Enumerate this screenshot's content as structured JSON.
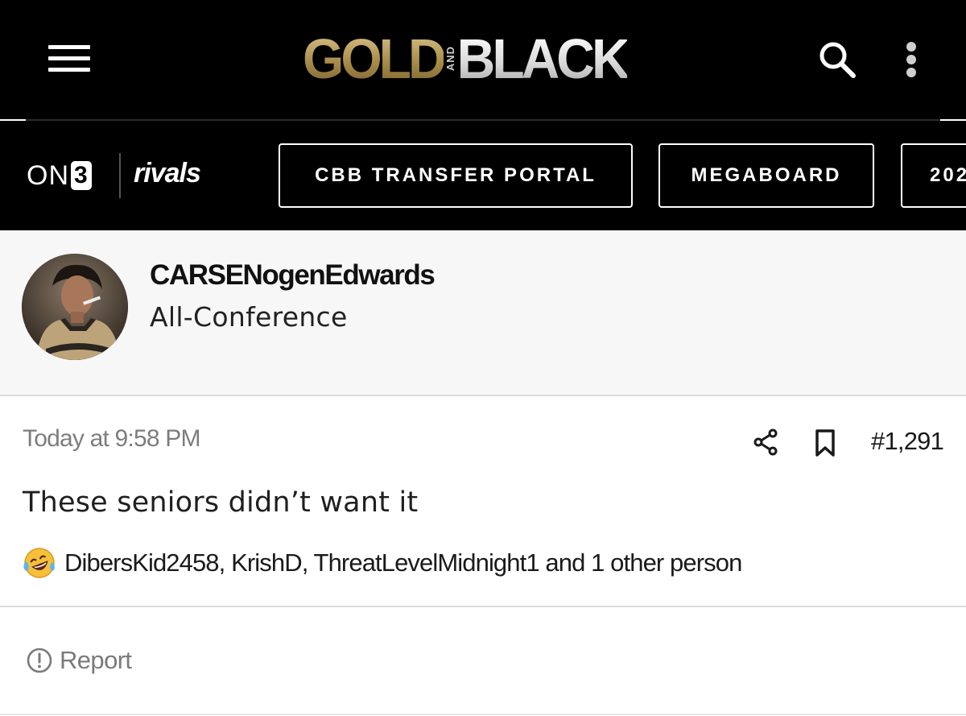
{
  "header": {
    "logo_gold": "GOLD",
    "logo_and": "AND",
    "logo_black": "BLACK",
    "menu_icon": "hamburger-menu-icon",
    "search_icon": "search-icon",
    "more_icon": "more-vertical-icon"
  },
  "subnav": {
    "brand_on3": "ON",
    "brand_on3_digit": "3",
    "brand_rivals": "rivals",
    "pills": [
      {
        "label": "CBB TRANSFER PORTAL"
      },
      {
        "label": "MEGABOARD"
      },
      {
        "label": "202"
      }
    ]
  },
  "author": {
    "username": "CARSENogenEdwards",
    "title": "All-Conference",
    "avatar_desc": "avatar"
  },
  "post": {
    "timestamp": "Today at 9:58 PM",
    "number": "#1,291",
    "text": "These seniors didn’t want it",
    "share_icon": "share-icon",
    "bookmark_icon": "bookmark-icon",
    "reaction_icon": "laughing-tears-emoji-icon",
    "reactions_text": "DibersKid2458, KrishD, ThreatLevelMidnight1 and 1 other person"
  },
  "footer": {
    "report_label": "Report",
    "report_icon": "alert-circle-icon"
  },
  "colors": {
    "header_bg": "#000000",
    "gold": "#b8a064",
    "user_bg": "#f7f7f7",
    "muted_text": "#7d7d7d"
  }
}
